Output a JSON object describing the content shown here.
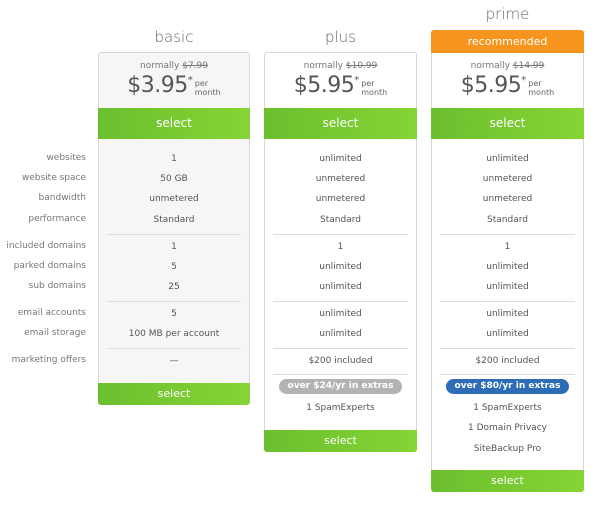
{
  "row_labels": [
    "websites",
    "website space",
    "bandwidth",
    "performance",
    "included domains",
    "parked domains",
    "sub domains",
    "email accounts",
    "email storage",
    "marketing offers"
  ],
  "colors": {
    "select_green": "#7acb32",
    "recommended_orange": "#f7941d",
    "extras_gray": "#b3b3b3",
    "extras_blue": "#2d6db5"
  },
  "plans": [
    {
      "name": "basic",
      "normally_label": "normally",
      "old_price": "$7.99",
      "price": "$3.95",
      "asterisk": "*",
      "per": "per",
      "month": "month",
      "select_label": "select",
      "values": [
        "1",
        "50 GB",
        "unmetered",
        "Standard",
        "1",
        "5",
        "25",
        "5",
        "100 MB per account",
        "—"
      ],
      "bottom_select_label": "select"
    },
    {
      "name": "plus",
      "normally_label": "normally",
      "old_price": "$10.99",
      "price": "$5.95",
      "asterisk": "*",
      "per": "per",
      "month": "month",
      "select_label": "select",
      "values": [
        "unlimited",
        "unmetered",
        "unmetered",
        "Standard",
        "1",
        "unlimited",
        "unlimited",
        "unlimited",
        "unlimited",
        "$200 included"
      ],
      "extras_badge": "over $24/yr in extras",
      "extras": [
        "1 SpamExperts"
      ],
      "bottom_select_label": "select"
    },
    {
      "name": "prime",
      "badge": "recommended",
      "normally_label": "normally",
      "old_price": "$14.99",
      "price": "$5.95",
      "asterisk": "*",
      "per": "per",
      "month": "month",
      "select_label": "select",
      "values": [
        "unlimited",
        "unmetered",
        "unmetered",
        "Standard",
        "1",
        "unlimited",
        "unlimited",
        "unlimited",
        "unlimited",
        "$200 included"
      ],
      "extras_badge": "over $80/yr in extras",
      "extras": [
        "1 SpamExperts",
        "1 Domain Privacy",
        "SiteBackup Pro"
      ],
      "bottom_select_label": "select"
    }
  ]
}
